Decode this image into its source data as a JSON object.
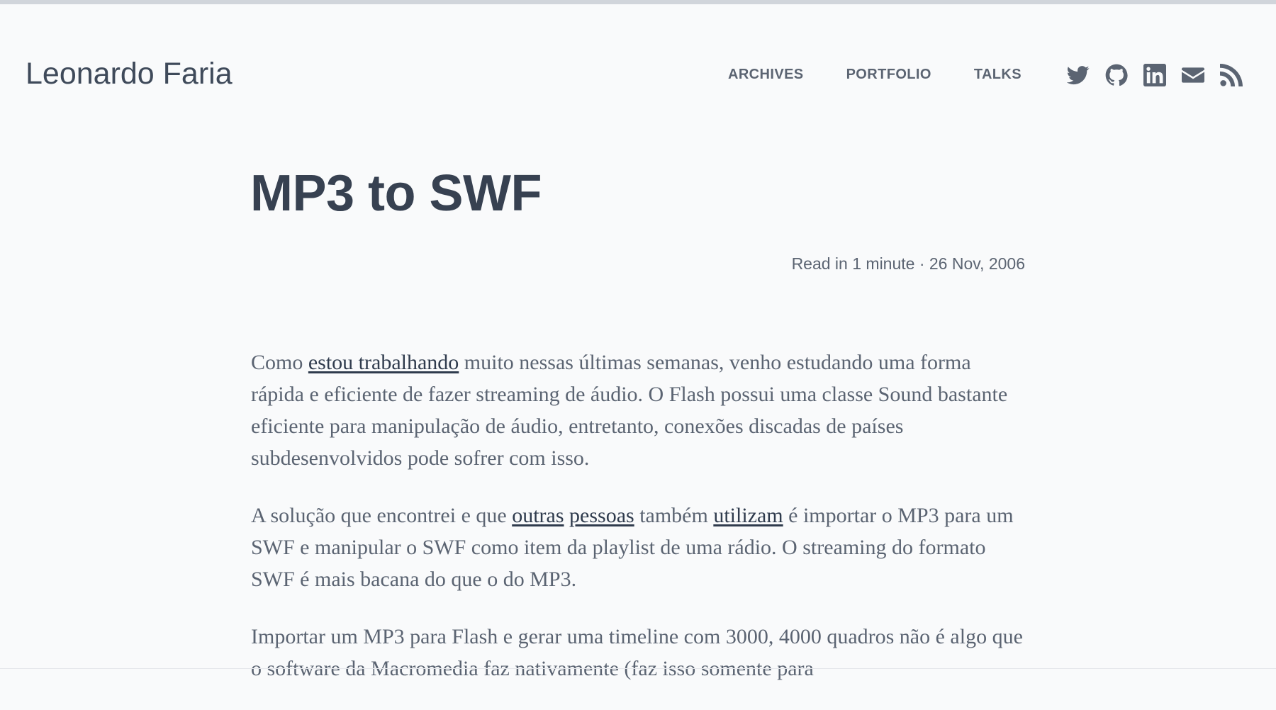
{
  "header": {
    "site_title": "Leonardo Faria",
    "nav": [
      "ARCHIVES",
      "PORTFOLIO",
      "TALKS"
    ],
    "social_icons": [
      "twitter-icon",
      "github-icon",
      "linkedin-icon",
      "email-icon",
      "rss-icon"
    ]
  },
  "post": {
    "title": "MP3 to SWF",
    "meta": "Read in 1 minute · 26 Nov, 2006"
  },
  "content": {
    "p1": {
      "t1": "Como ",
      "link1": "estou trabalhando",
      "t2": " muito nessas últimas semanas, venho estudando uma forma rápida e eficiente de fazer streaming de áudio. O Flash possui uma classe Sound bastante eficiente para manipulação de áudio, entretanto, conexões discadas de países subdesenvolvidos pode sofrer com isso."
    },
    "p2": {
      "t1": "A solução que encontrei e que ",
      "link1": "outras",
      "sp": " ",
      "link2": "pessoas",
      "t2": " também ",
      "link3": "utilizam",
      "t3": " é importar o MP3 para um SWF e manipular o SWF como item da playlist de uma rádio. O streaming do formato SWF é mais bacana do que o do MP3."
    },
    "p3": {
      "t1": "Importar um MP3 para Flash e gerar uma timeline com 3000, 4000 quadros não é algo que o software da Macromedia faz nativamente (faz isso somente para"
    }
  },
  "colors": {
    "background": "#f9fafb",
    "text": "#5b6472",
    "heading": "#374151",
    "link": "#2f3b4d"
  }
}
